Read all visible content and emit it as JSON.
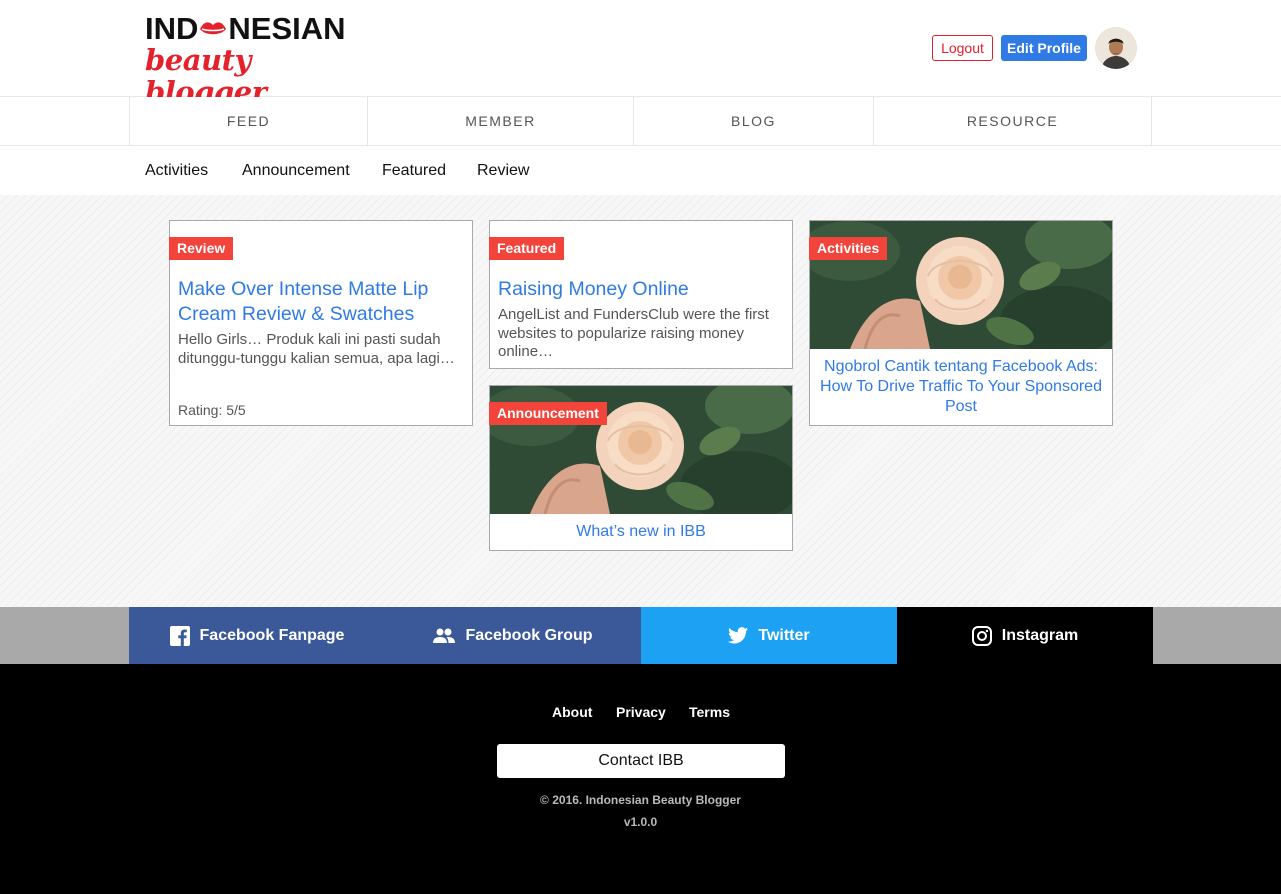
{
  "brand": {
    "logo_top_a": "IND",
    "logo_top_b": "NESIAN",
    "logo_bottom": "beauty blogger",
    "accent": "#e3222c"
  },
  "header": {
    "logout_label": "Logout",
    "edit_profile_label": "Edit Profile"
  },
  "main_nav": {
    "tabs": [
      {
        "label": "FEED"
      },
      {
        "label": "MEMBER"
      },
      {
        "label": "BLOG"
      },
      {
        "label": "RESOURCE"
      }
    ]
  },
  "sub_nav": {
    "items": [
      {
        "label": "Activities"
      },
      {
        "label": "Announcement"
      },
      {
        "label": "Featured"
      },
      {
        "label": "Review"
      }
    ]
  },
  "cards": {
    "review": {
      "badge": "Review",
      "title": "Make Over Intense Matte Lip Cream Review & Swatches",
      "excerpt": "Hello Girls… Produk kali ini pasti sudah ditunggu-tunggu kalian semua, apa lagi…",
      "rating": "Rating: 5/5"
    },
    "featured": {
      "badge": "Featured",
      "title": "Raising Money Online",
      "excerpt": "AngelList and FundersClub were the first websites to popularize raising money online…"
    },
    "announcement": {
      "badge": "Announcement",
      "caption": "What’s new in IBB"
    },
    "activities": {
      "badge": "Activities",
      "caption": "Ngobrol Cantik tentang Facebook Ads: How To Drive Traffic To Your Sponsored Post"
    }
  },
  "social": {
    "items": [
      {
        "label": "Facebook Fanpage",
        "icon": "facebook-icon",
        "color": "#3b5998"
      },
      {
        "label": "Facebook Group",
        "icon": "group-icon",
        "color": "#3b5998"
      },
      {
        "label": "Twitter",
        "icon": "twitter-icon",
        "color": "#1da1f2"
      },
      {
        "label": "Instagram",
        "icon": "instagram-icon",
        "color": "#000000"
      }
    ]
  },
  "footer": {
    "links": [
      {
        "label": "About"
      },
      {
        "label": "Privacy"
      },
      {
        "label": "Terms"
      }
    ],
    "contact_label": "Contact IBB",
    "copyright": "© 2016. Indonesian Beauty Blogger",
    "version": "v1.0.0"
  }
}
